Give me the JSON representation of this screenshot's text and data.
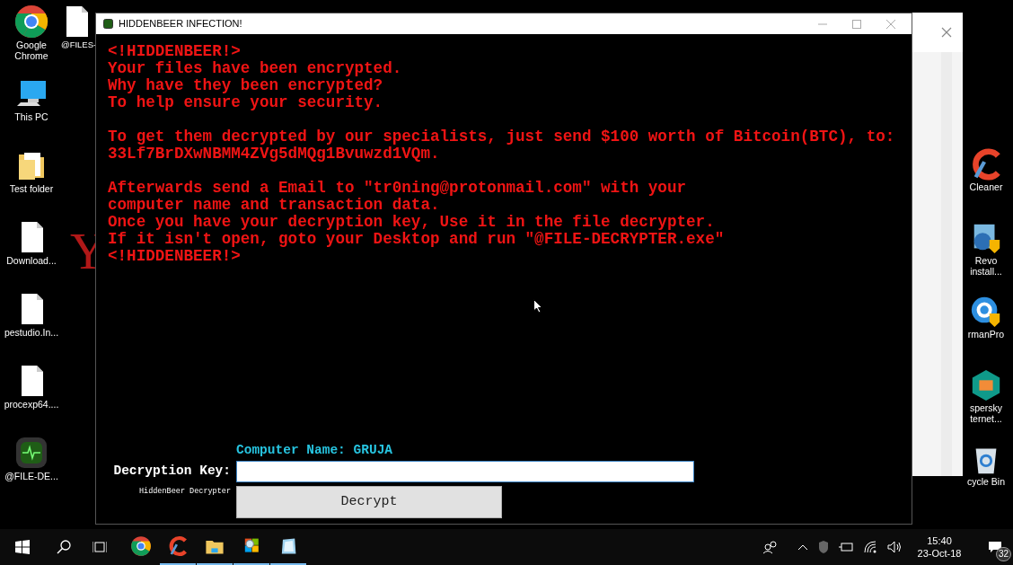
{
  "desktop": {
    "left_icons": [
      {
        "label": "Google Chrome",
        "kind": "chrome"
      },
      {
        "label": "This PC",
        "kind": "pc"
      },
      {
        "label": "Test folder",
        "kind": "folder"
      },
      {
        "label": "Download...",
        "kind": "file"
      },
      {
        "label": "pestudio.In...",
        "kind": "file"
      },
      {
        "label": "procexp64....",
        "kind": "file"
      },
      {
        "label": "@FILE-DE...",
        "kind": "app"
      }
    ],
    "top_icon": {
      "label": "@FILES-",
      "kind": "file"
    },
    "wallpaper_letter": "Y",
    "right_icons": [
      {
        "lines": [
          "Cleaner"
        ],
        "kind": "ccleaner"
      },
      {
        "lines": [
          "Revo",
          "install..."
        ],
        "kind": "revo"
      },
      {
        "lines": [
          "rmanPro"
        ],
        "kind": "hitman"
      },
      {
        "lines": [
          "spersky",
          "ternet..."
        ],
        "kind": "kaspersky"
      },
      {
        "lines": [
          "cycle Bin"
        ],
        "kind": "recycle"
      }
    ]
  },
  "window": {
    "title": "HIDDENBEER INFECTION!",
    "message": [
      [
        "<!HIDDENBEER!>",
        "Your files have been encrypted.",
        "Why have they been encrypted?",
        "To help ensure your security."
      ],
      [
        "To get them decrypted by our specialists, just send $100 worth of Bitcoin(BTC), to:",
        "33Lf7BrDXwNBMM4ZVg5dMQg1Bvuwzd1VQm."
      ],
      [
        "Afterwards send a Email to \"tr0ning@protonmail.com\" with your",
        "computer name and transaction data.",
        "Once you have your decryption key, Use it in the file decrypter.",
        "If it isn't open, goto your Desktop and run \"@FILE-DECRYPTER.exe\"",
        "<!HIDDENBEER!>"
      ]
    ],
    "computer_name": "Computer Name: GRUJA",
    "key_label": "Decryption Key:",
    "caption": "HiddenBeer Decrypter",
    "button": "Decrypt"
  },
  "taskbar": {
    "apps": [
      {
        "kind": "chrome",
        "running": false
      },
      {
        "kind": "ccleaner",
        "running": true
      },
      {
        "kind": "explorer",
        "running": true
      },
      {
        "kind": "magnifier",
        "running": true
      },
      {
        "kind": "notepad",
        "running": true
      }
    ],
    "time": "15:40",
    "date": "23-Oct-18",
    "notifications": "32"
  }
}
